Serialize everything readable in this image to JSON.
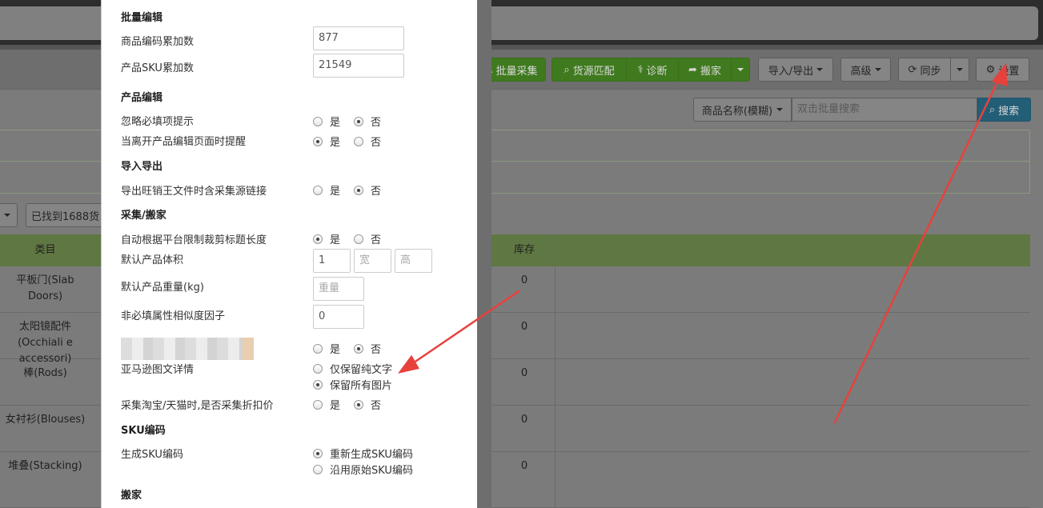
{
  "toolbar": {
    "batch_collect": "批量采集",
    "source_match": "货源匹配",
    "diagnose": "诊断",
    "move": "搬家",
    "import_export": "导入/导出",
    "advanced": "高级",
    "sync": "同步",
    "settings": "设置"
  },
  "search": {
    "field_select": "商品名称(模糊)",
    "placeholder": "双击批量搜索",
    "button": "搜索"
  },
  "found_button": "已找到1688货",
  "table": {
    "col_category": "类目",
    "col_stock": "库存",
    "rows": [
      {
        "category": "平板门(Slab Doors)",
        "stock": "0"
      },
      {
        "category": "太阳镜配件(Occhiali e accessori)",
        "stock": "0"
      },
      {
        "category": "棒(Rods)",
        "stock": "0"
      },
      {
        "category": "女衬衫(Blouses)",
        "stock": "0"
      },
      {
        "category": "堆叠(Stacking)",
        "stock": "0"
      }
    ]
  },
  "modal": {
    "batch_edit": {
      "title": "批量编辑",
      "code_inc_label": "商品编码累加数",
      "code_inc_value": "877",
      "sku_inc_label": "产品SKU累加数",
      "sku_inc_value": "21549"
    },
    "product_edit": {
      "title": "产品编辑",
      "ignore_required_label": "忽略必填项提示",
      "leave_page_label": "当离开产品编辑页面时提醒"
    },
    "import_export": {
      "title": "导入导出",
      "export_link_label": "导出旺销王文件时含采集源链接"
    },
    "collect": {
      "title": "采集/搬家",
      "auto_trim_label": "自动根据平台限制裁剪标题长度",
      "default_volume_label": "默认产品体积",
      "volume_value": "1",
      "width_placeholder": "宽",
      "height_placeholder": "高",
      "default_weight_label": "默认产品重量(kg)",
      "weight_placeholder": "重量",
      "similarity_label": "非必填属性相似度因子",
      "similarity_value": "0",
      "amazon_label": "亚马逊图文详情",
      "amazon_text_only": "仅保留纯文字",
      "amazon_keep_images": "保留所有图片",
      "taobao_discount_label": "采集淘宝/天猫时,是否采集折扣价"
    },
    "sku": {
      "title": "SKU编码",
      "generate_label": "生成SKU编码",
      "regen": "重新生成SKU编码",
      "keep_original": "沿用原始SKU编码"
    },
    "move_title": "搬家",
    "yes": "是",
    "no": "否"
  },
  "colors": {
    "arrow": "#e8413c",
    "green_button": "#3f7a1e",
    "search_button": "#235e77",
    "table_header": "#5f7742"
  }
}
